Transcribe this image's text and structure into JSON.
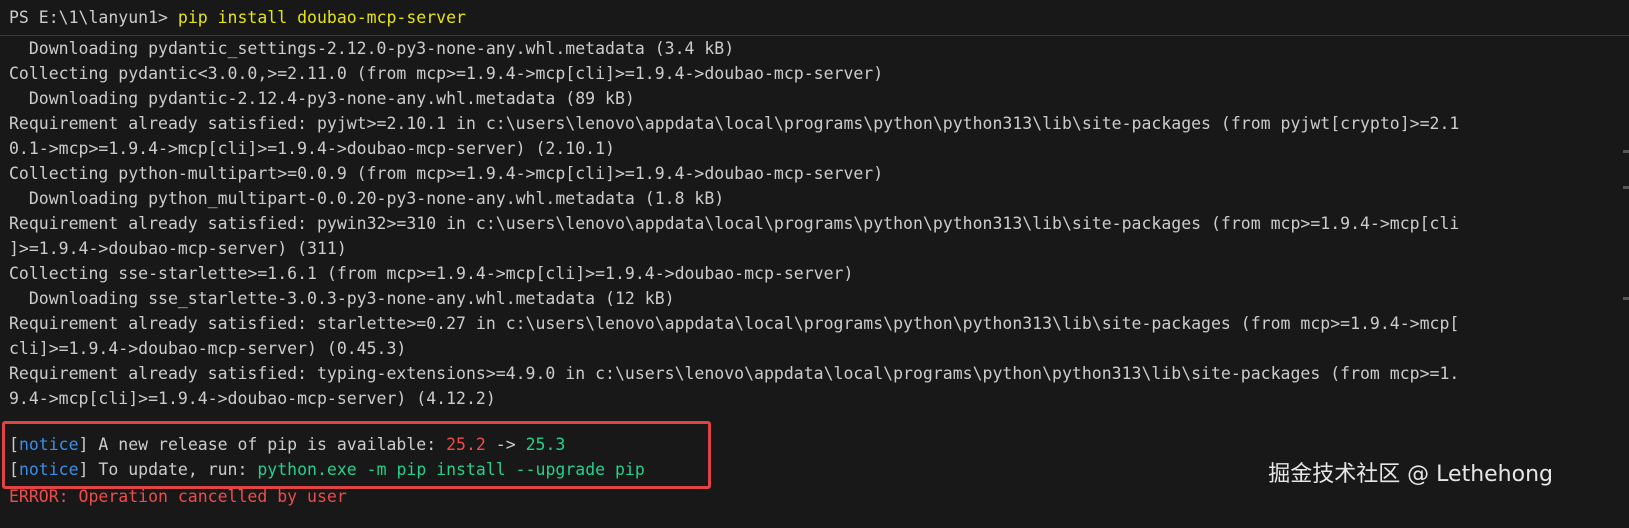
{
  "prompt": {
    "path": "PS E:\\1\\lanyun1> ",
    "command": "pip install doubao-mcp-server"
  },
  "output_lines": [
    "  Downloading pydantic_settings-2.12.0-py3-none-any.whl.metadata (3.4 kB)",
    "Collecting pydantic<3.0.0,>=2.11.0 (from mcp>=1.9.4->mcp[cli]>=1.9.4->doubao-mcp-server)",
    "  Downloading pydantic-2.12.4-py3-none-any.whl.metadata (89 kB)",
    "Requirement already satisfied: pyjwt>=2.10.1 in c:\\users\\lenovo\\appdata\\local\\programs\\python\\python313\\lib\\site-packages (from pyjwt[crypto]>=2.1",
    "0.1->mcp>=1.9.4->mcp[cli]>=1.9.4->doubao-mcp-server) (2.10.1)",
    "Collecting python-multipart>=0.0.9 (from mcp>=1.9.4->mcp[cli]>=1.9.4->doubao-mcp-server)",
    "  Downloading python_multipart-0.0.20-py3-none-any.whl.metadata (1.8 kB)",
    "Requirement already satisfied: pywin32>=310 in c:\\users\\lenovo\\appdata\\local\\programs\\python\\python313\\lib\\site-packages (from mcp>=1.9.4->mcp[cli",
    "]>=1.9.4->doubao-mcp-server) (311)",
    "Collecting sse-starlette>=1.6.1 (from mcp>=1.9.4->mcp[cli]>=1.9.4->doubao-mcp-server)",
    "  Downloading sse_starlette-3.0.3-py3-none-any.whl.metadata (12 kB)",
    "Requirement already satisfied: starlette>=0.27 in c:\\users\\lenovo\\appdata\\local\\programs\\python\\python313\\lib\\site-packages (from mcp>=1.9.4->mcp[",
    "cli]>=1.9.4->doubao-mcp-server) (0.45.3)",
    "Requirement already satisfied: typing-extensions>=4.9.0 in c:\\users\\lenovo\\appdata\\local\\programs\\python\\python313\\lib\\site-packages (from mcp>=1.",
    "9.4->mcp[cli]>=1.9.4->doubao-mcp-server) (4.12.2)"
  ],
  "notice": {
    "tag": "notice",
    "line1_text": " A new release of pip is available: ",
    "old_version": "25.2",
    "arrow": " -> ",
    "new_version": "25.3",
    "line2_text": " To update, run: ",
    "update_command": "python.exe -m pip install --upgrade pip"
  },
  "error": "ERROR: Operation cancelled by user",
  "watermark": "掘金技术社区 @ Lethehong",
  "colors": {
    "background": "#181818",
    "text": "#cccccc",
    "command": "#e5e510",
    "notice_tag": "#3b8eea",
    "old_version": "#f14c4c",
    "new_version": "#23d18b",
    "error": "#f14c4c",
    "highlight_box": "#e04343"
  }
}
